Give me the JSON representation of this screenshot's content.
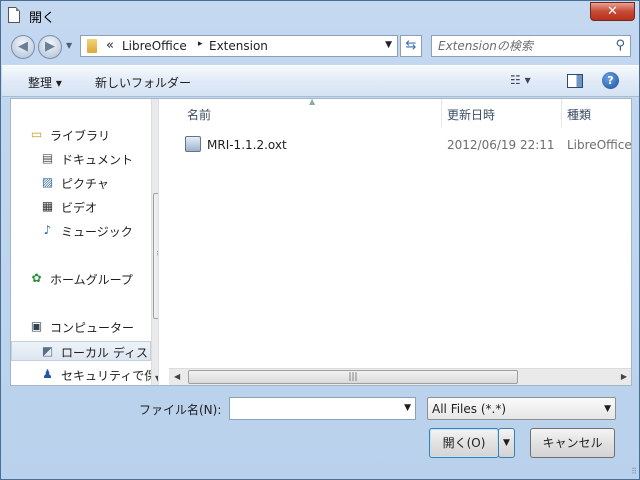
{
  "window": {
    "title": "開く",
    "close_label": "✕"
  },
  "address": {
    "chevrons": "«",
    "segments": [
      "LibreOffice",
      "Extension"
    ],
    "separator": "▸"
  },
  "search": {
    "placeholder": "Extensionの検索"
  },
  "toolbar": {
    "organize_label": "整理 ▾",
    "new_folder_label": "新しいフォルダー",
    "view_label": "☷ ▾",
    "help_label": "?"
  },
  "nav": {
    "items": [
      {
        "label": "ライブラリ",
        "icon": "library-icon",
        "glyph": "▭"
      },
      {
        "label": "ドキュメント",
        "icon": "documents-icon",
        "glyph": "▤"
      },
      {
        "label": "ピクチャ",
        "icon": "pictures-icon",
        "glyph": "▨"
      },
      {
        "label": "ビデオ",
        "icon": "video-icon",
        "glyph": "▦"
      },
      {
        "label": "ミュージック",
        "icon": "music-icon",
        "glyph": "♪"
      },
      {
        "label": "ホームグループ",
        "icon": "homegroup-icon",
        "glyph": "✿"
      },
      {
        "label": "コンピューター",
        "icon": "computer-icon",
        "glyph": "▣"
      },
      {
        "label": "ローカル ディス",
        "icon": "local-disk-icon",
        "glyph": "◩"
      },
      {
        "label": "セキュリティで保",
        "icon": "secure-drive-icon",
        "glyph": "♟"
      }
    ]
  },
  "columns": {
    "name": "名前",
    "date": "更新日時",
    "type": "種類"
  },
  "files": [
    {
      "name": "MRI-1.1.2.oxt",
      "date": "2012/06/19 22:11",
      "type": "LibreOffice"
    }
  ],
  "bottom": {
    "filename_label": "ファイル名(N):",
    "filename_value": "",
    "filter_value": "All Files (*.*)",
    "open_label": "開く(O)",
    "cancel_label": "キャンセル"
  }
}
